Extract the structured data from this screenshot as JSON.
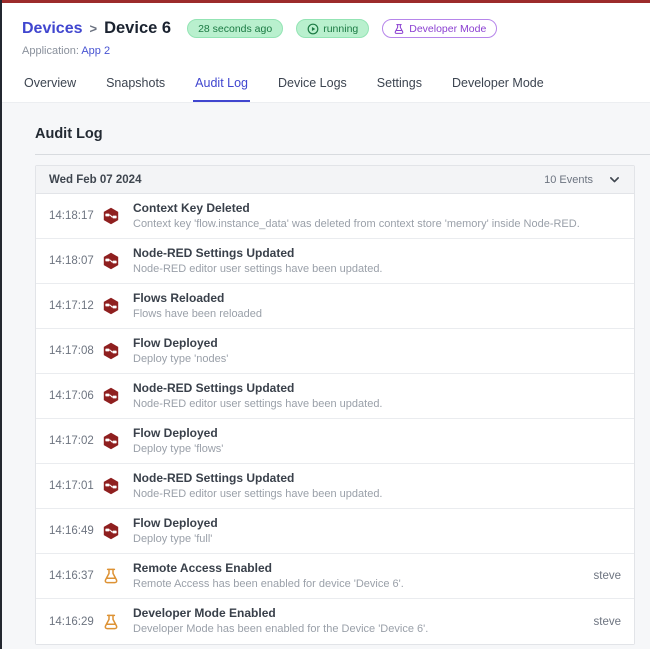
{
  "header": {
    "breadcrumb": {
      "parent": "Devices",
      "separator": ">",
      "current": "Device 6"
    },
    "badges": {
      "last_seen": "28 seconds ago",
      "status": "running",
      "developer_mode": "Developer Mode"
    },
    "application_label": "Application:",
    "application_name": "App 2"
  },
  "tabs": [
    {
      "label": "Overview",
      "active": false
    },
    {
      "label": "Snapshots",
      "active": false
    },
    {
      "label": "Audit Log",
      "active": true
    },
    {
      "label": "Device Logs",
      "active": false
    },
    {
      "label": "Settings",
      "active": false
    },
    {
      "label": "Developer Mode",
      "active": false
    }
  ],
  "main": {
    "title": "Audit Log",
    "group": {
      "date": "Wed Feb 07 2024",
      "events_count": "10 Events",
      "collapse_icon": "chevron-down-icon"
    },
    "entries": [
      {
        "time": "14:18:17",
        "icon": "node-red",
        "title": "Context Key Deleted",
        "description": "Context key 'flow.instance_data' was deleted from context store 'memory' inside Node-RED.",
        "user": ""
      },
      {
        "time": "14:18:07",
        "icon": "node-red",
        "title": "Node-RED Settings Updated",
        "description": "Node-RED editor user settings have been updated.",
        "user": ""
      },
      {
        "time": "14:17:12",
        "icon": "node-red",
        "title": "Flows Reloaded",
        "description": "Flows have been reloaded",
        "user": ""
      },
      {
        "time": "14:17:08",
        "icon": "node-red",
        "title": "Flow Deployed",
        "description": "Deploy type 'nodes'",
        "user": ""
      },
      {
        "time": "14:17:06",
        "icon": "node-red",
        "title": "Node-RED Settings Updated",
        "description": "Node-RED editor user settings have been updated.",
        "user": ""
      },
      {
        "time": "14:17:02",
        "icon": "node-red",
        "title": "Flow Deployed",
        "description": "Deploy type 'flows'",
        "user": ""
      },
      {
        "time": "14:17:01",
        "icon": "node-red",
        "title": "Node-RED Settings Updated",
        "description": "Node-RED editor user settings have been updated.",
        "user": ""
      },
      {
        "time": "14:16:49",
        "icon": "node-red",
        "title": "Flow Deployed",
        "description": "Deploy type 'full'",
        "user": ""
      },
      {
        "time": "14:16:37",
        "icon": "flask",
        "title": "Remote Access Enabled",
        "description": "Remote Access has been enabled for device 'Device 6'.",
        "user": "steve"
      },
      {
        "time": "14:16:29",
        "icon": "flask",
        "title": "Developer Mode Enabled",
        "description": "Developer Mode has been enabled for the Device 'Device 6'.",
        "user": "steve"
      }
    ]
  },
  "colors": {
    "accent_indigo": "#4046cf",
    "status_green_bg": "#b9f0ce",
    "status_green_text": "#1b7a43",
    "developer_purple": "#8b3fd1",
    "node_red_brand": "#8f1f1f",
    "flask_amber": "#dd9234",
    "window_top_bar": "#9c2b2b",
    "window_left_edge": "#232730"
  }
}
